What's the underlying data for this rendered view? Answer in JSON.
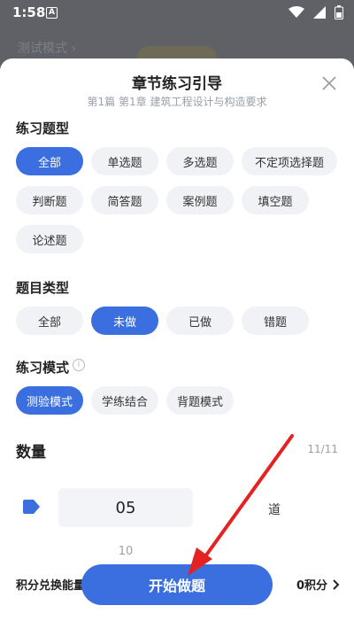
{
  "status_bar": {
    "time": "1:58",
    "notif_letter": "A"
  },
  "behind": {
    "title": "测试模式 ›"
  },
  "sheet": {
    "title": "章节练习引导",
    "subtitle": "第1篇  第1章  建筑工程设计与构造要求"
  },
  "question_type": {
    "title": "练习题型",
    "options": [
      "全部",
      "单选题",
      "多选题",
      "不定项选择题",
      "判断题",
      "简答题",
      "案例题",
      "填空题",
      "论述题"
    ],
    "selected": "全部"
  },
  "item_type": {
    "title": "题目类型",
    "options": [
      "全部",
      "未做",
      "已做",
      "错题"
    ],
    "selected": "未做"
  },
  "mode": {
    "title": "练习模式",
    "options": [
      "测验模式",
      "学练结合",
      "背题模式"
    ],
    "selected": "测验模式"
  },
  "count": {
    "title": "数量",
    "total": "11/11",
    "current": "05",
    "next": "10",
    "unit": "道"
  },
  "bottom": {
    "left_label": "积分兑换能量",
    "right_label": "0积分",
    "start_label": "开始做题"
  },
  "colors": {
    "accent": "#3b6fdf",
    "arrow": "#e52222"
  }
}
